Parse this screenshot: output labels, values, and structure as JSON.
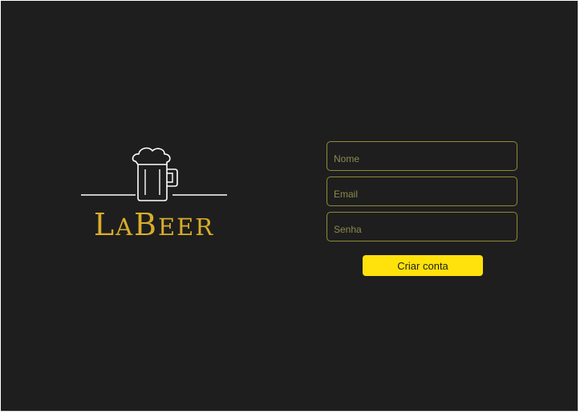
{
  "brand": {
    "name_first_cap": "L",
    "name_part1": "A",
    "name_second_cap": "B",
    "name_part2": "EER",
    "logo_icon": "beer-mug-icon",
    "accent_color": "#d8ad2a"
  },
  "form": {
    "name_placeholder": "Nome",
    "email_placeholder": "Email",
    "password_placeholder": "Senha",
    "submit_label": "Criar conta",
    "button_color": "#ffe20b",
    "field_border_color": "#8e8b35"
  }
}
